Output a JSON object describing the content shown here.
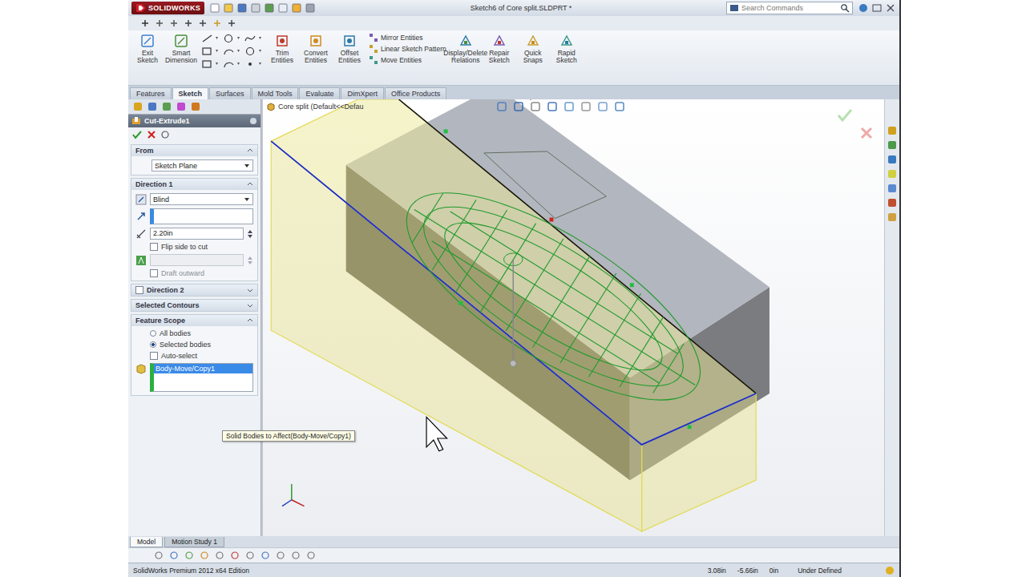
{
  "window": {
    "app": "SOLIDWORKS",
    "title": "Sketch6 of Core split.SLDPRT *"
  },
  "search": {
    "placeholder": "Search Commands"
  },
  "ribbon": {
    "commands": [
      "Exit Sketch",
      "Smart Dimension"
    ],
    "more_commands": [
      "Trim Entities",
      "Convert Entities",
      "Offset Entities"
    ],
    "small_commands": [
      "Mirror Entities",
      "Linear Sketch Pattern",
      "Move Entities"
    ],
    "right_commands": [
      "Display/Delete Relations",
      "Repair Sketch",
      "Quick Snaps",
      "Rapid Sketch"
    ]
  },
  "tabs": [
    {
      "label": "Features",
      "selected": false
    },
    {
      "label": "Sketch",
      "selected": true
    },
    {
      "label": "Surfaces",
      "selected": false
    },
    {
      "label": "Mold Tools",
      "selected": false
    },
    {
      "label": "Evaluate",
      "selected": false
    },
    {
      "label": "DimXpert",
      "selected": false
    },
    {
      "label": "Office Products",
      "selected": false
    }
  ],
  "property_manager": {
    "title": "Cut-Extrude1",
    "from": {
      "header": "From",
      "value": "Sketch Plane"
    },
    "direction1": {
      "header": "Direction 1",
      "end_condition": "Blind",
      "depth": "2.20in",
      "flip_label": "Flip side to cut",
      "flip_checked": false,
      "draft_outward_label": "Draft outward",
      "draft_outward_checked": false,
      "draft_enabled": false
    },
    "direction2": {
      "header": "Direction 2",
      "checked": false,
      "expanded": false
    },
    "selected_contours": {
      "header": "Selected Contours",
      "expanded": false
    },
    "feature_scope": {
      "header": "Feature Scope",
      "options": [
        {
          "label": "All bodies",
          "selected": false
        },
        {
          "label": "Selected bodies",
          "selected": true
        }
      ],
      "auto_select": {
        "label": "Auto-select",
        "checked": false
      },
      "bodies": [
        {
          "label": "Body-Move/Copy1",
          "selected": true
        }
      ]
    }
  },
  "tooltip": "Solid Bodies to Affect(Body-Move/Copy1)",
  "viewport": {
    "tree_flyout": "Core split  (Default<<Defau"
  },
  "bottom_tabs": [
    {
      "label": "Model",
      "selected": true
    },
    {
      "label": "Motion Study 1",
      "selected": false
    }
  ],
  "status_bar": {
    "product": "SolidWorks Premium 2012 x64 Edition",
    "x": "3.08in",
    "y": "-5.66in",
    "z": "0in",
    "state": "Under Defined"
  }
}
